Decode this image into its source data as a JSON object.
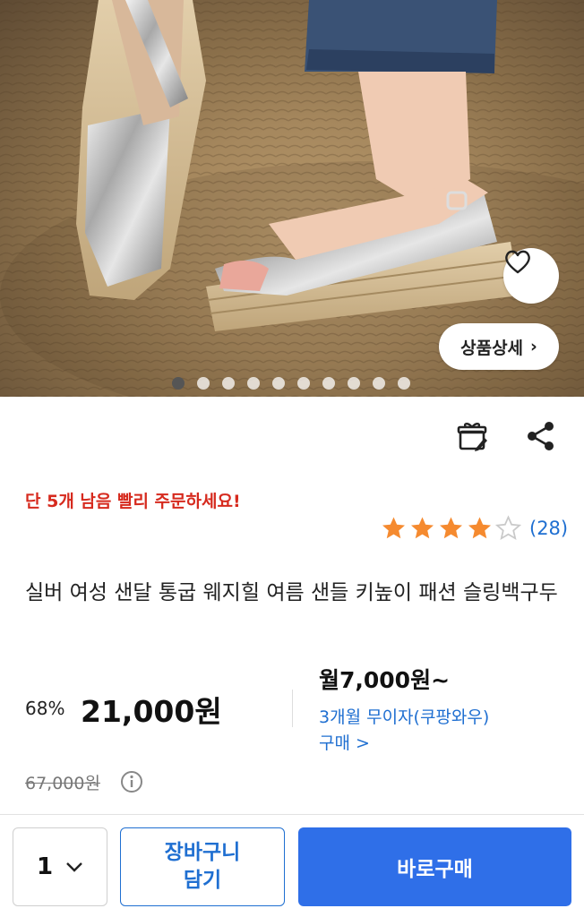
{
  "hero": {
    "image_alt": "silver wedge espadrille sandals",
    "detail_button_label": "상품상세",
    "detail_chevron": "›",
    "carousel_total": 10,
    "carousel_active": 1
  },
  "product": {
    "urgency_text": "단 5개 남음 빨리 주문하세요!",
    "rating_value": 4,
    "rating_max": 5,
    "review_count": "(28)",
    "title": "실버 여성 샌달 통굽 웨지힐 여름 샌들 키높이 패션 슬링백구두"
  },
  "pricing": {
    "discount": "68%",
    "price": "21,000원",
    "monthly": "월7,000원~",
    "installment": "3개월 무이자(쿠팡와우) 구매 >",
    "original_price": "67,000원"
  },
  "actions": {
    "quantity": "1",
    "cart_label": "장바구니\n담기",
    "buy_label": "바로구매"
  },
  "colors": {
    "accent_blue": "#2f6fe8",
    "link_blue": "#1f6fd1",
    "urgency_red": "#d62a1e",
    "star_orange": "#f58a2f"
  }
}
